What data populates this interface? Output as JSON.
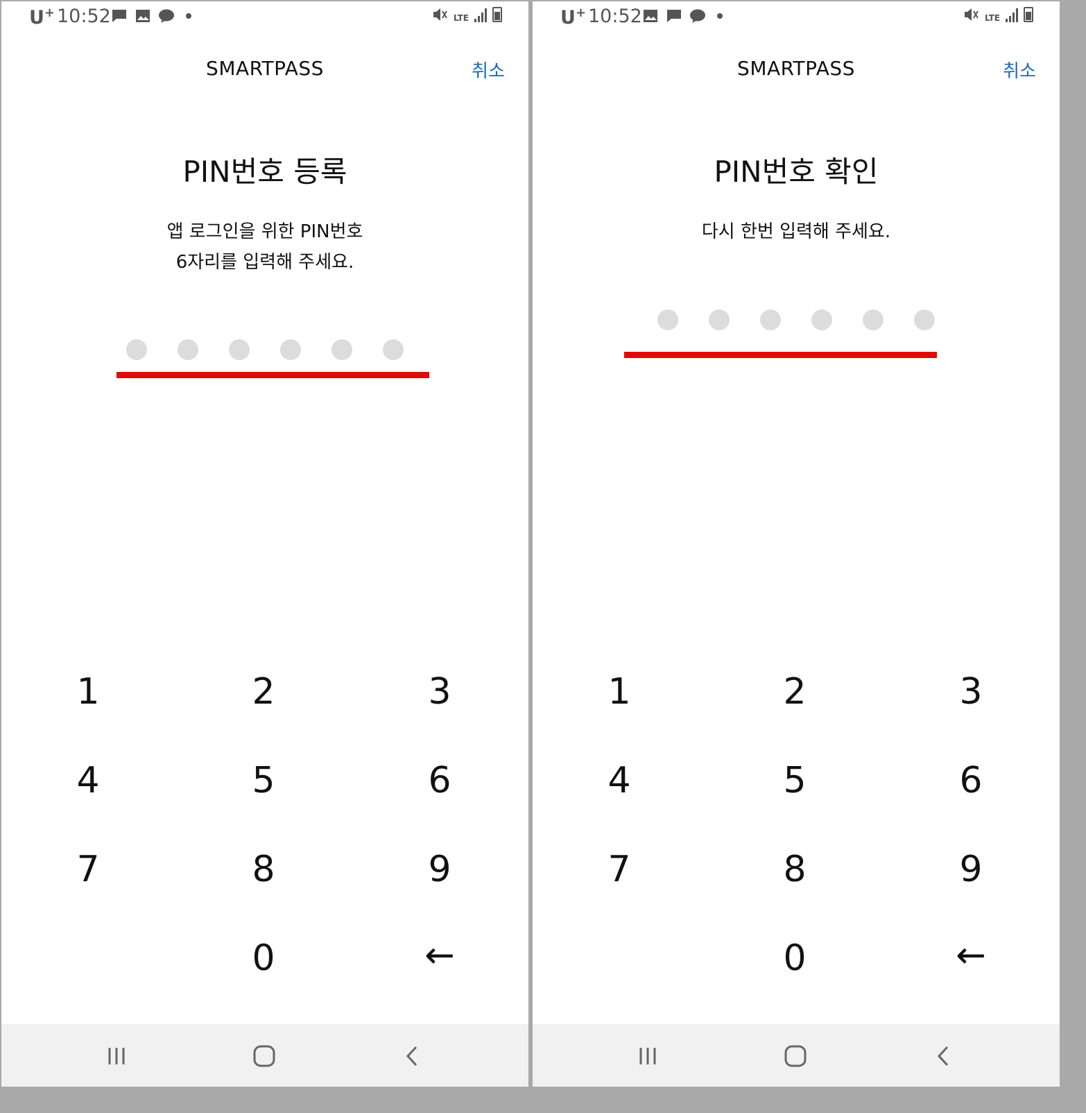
{
  "colors": {
    "accent_red": "#e00b0b",
    "link_blue": "#1a68b8",
    "dot_gray": "#dcdcdc",
    "nav_bg": "#f1f1f1"
  },
  "screens": [
    {
      "status": {
        "carrier": "U",
        "carrier_mark": "+",
        "time": "10:52",
        "network": "LTE"
      },
      "app_title": "SMARTPASS",
      "cancel_label": "취소",
      "heading": "PIN번호 등록",
      "description_line1": "앱 로그인을 위한 PIN번호",
      "description_line2": "6자리를 입력해 주세요.",
      "pin_length": 6,
      "pin_entered": 0,
      "keys": [
        "1",
        "2",
        "3",
        "4",
        "5",
        "6",
        "7",
        "8",
        "9",
        "0",
        "←"
      ]
    },
    {
      "status": {
        "carrier": "U",
        "carrier_mark": "+",
        "time": "10:52",
        "network": "LTE"
      },
      "app_title": "SMARTPASS",
      "cancel_label": "취소",
      "heading": "PIN번호 확인",
      "description_line1": "다시 한번 입력해 주세요.",
      "description_line2": "",
      "pin_length": 6,
      "pin_entered": 0,
      "keys": [
        "1",
        "2",
        "3",
        "4",
        "5",
        "6",
        "7",
        "8",
        "9",
        "0",
        "←"
      ]
    }
  ]
}
